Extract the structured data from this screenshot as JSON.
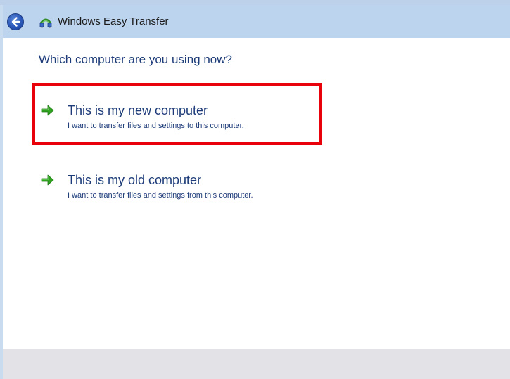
{
  "window": {
    "title": "Windows Easy Transfer"
  },
  "icons": {
    "back": "back-arrow-icon",
    "app": "easy-transfer-icon",
    "option_arrow": "green-arrow-icon"
  },
  "main": {
    "question": "Which computer are you using now?",
    "options": [
      {
        "title": "This is my new computer",
        "description": "I want to transfer files and settings to this computer."
      },
      {
        "title": "This is my old computer",
        "description": "I want to transfer files and settings from this computer."
      }
    ]
  },
  "colors": {
    "title_bar": "#bcd4ee",
    "heading_text": "#1c3b78",
    "highlight": "#e8000a",
    "arrow_green": "#2fa21f",
    "footer": "#e3e3e7"
  }
}
